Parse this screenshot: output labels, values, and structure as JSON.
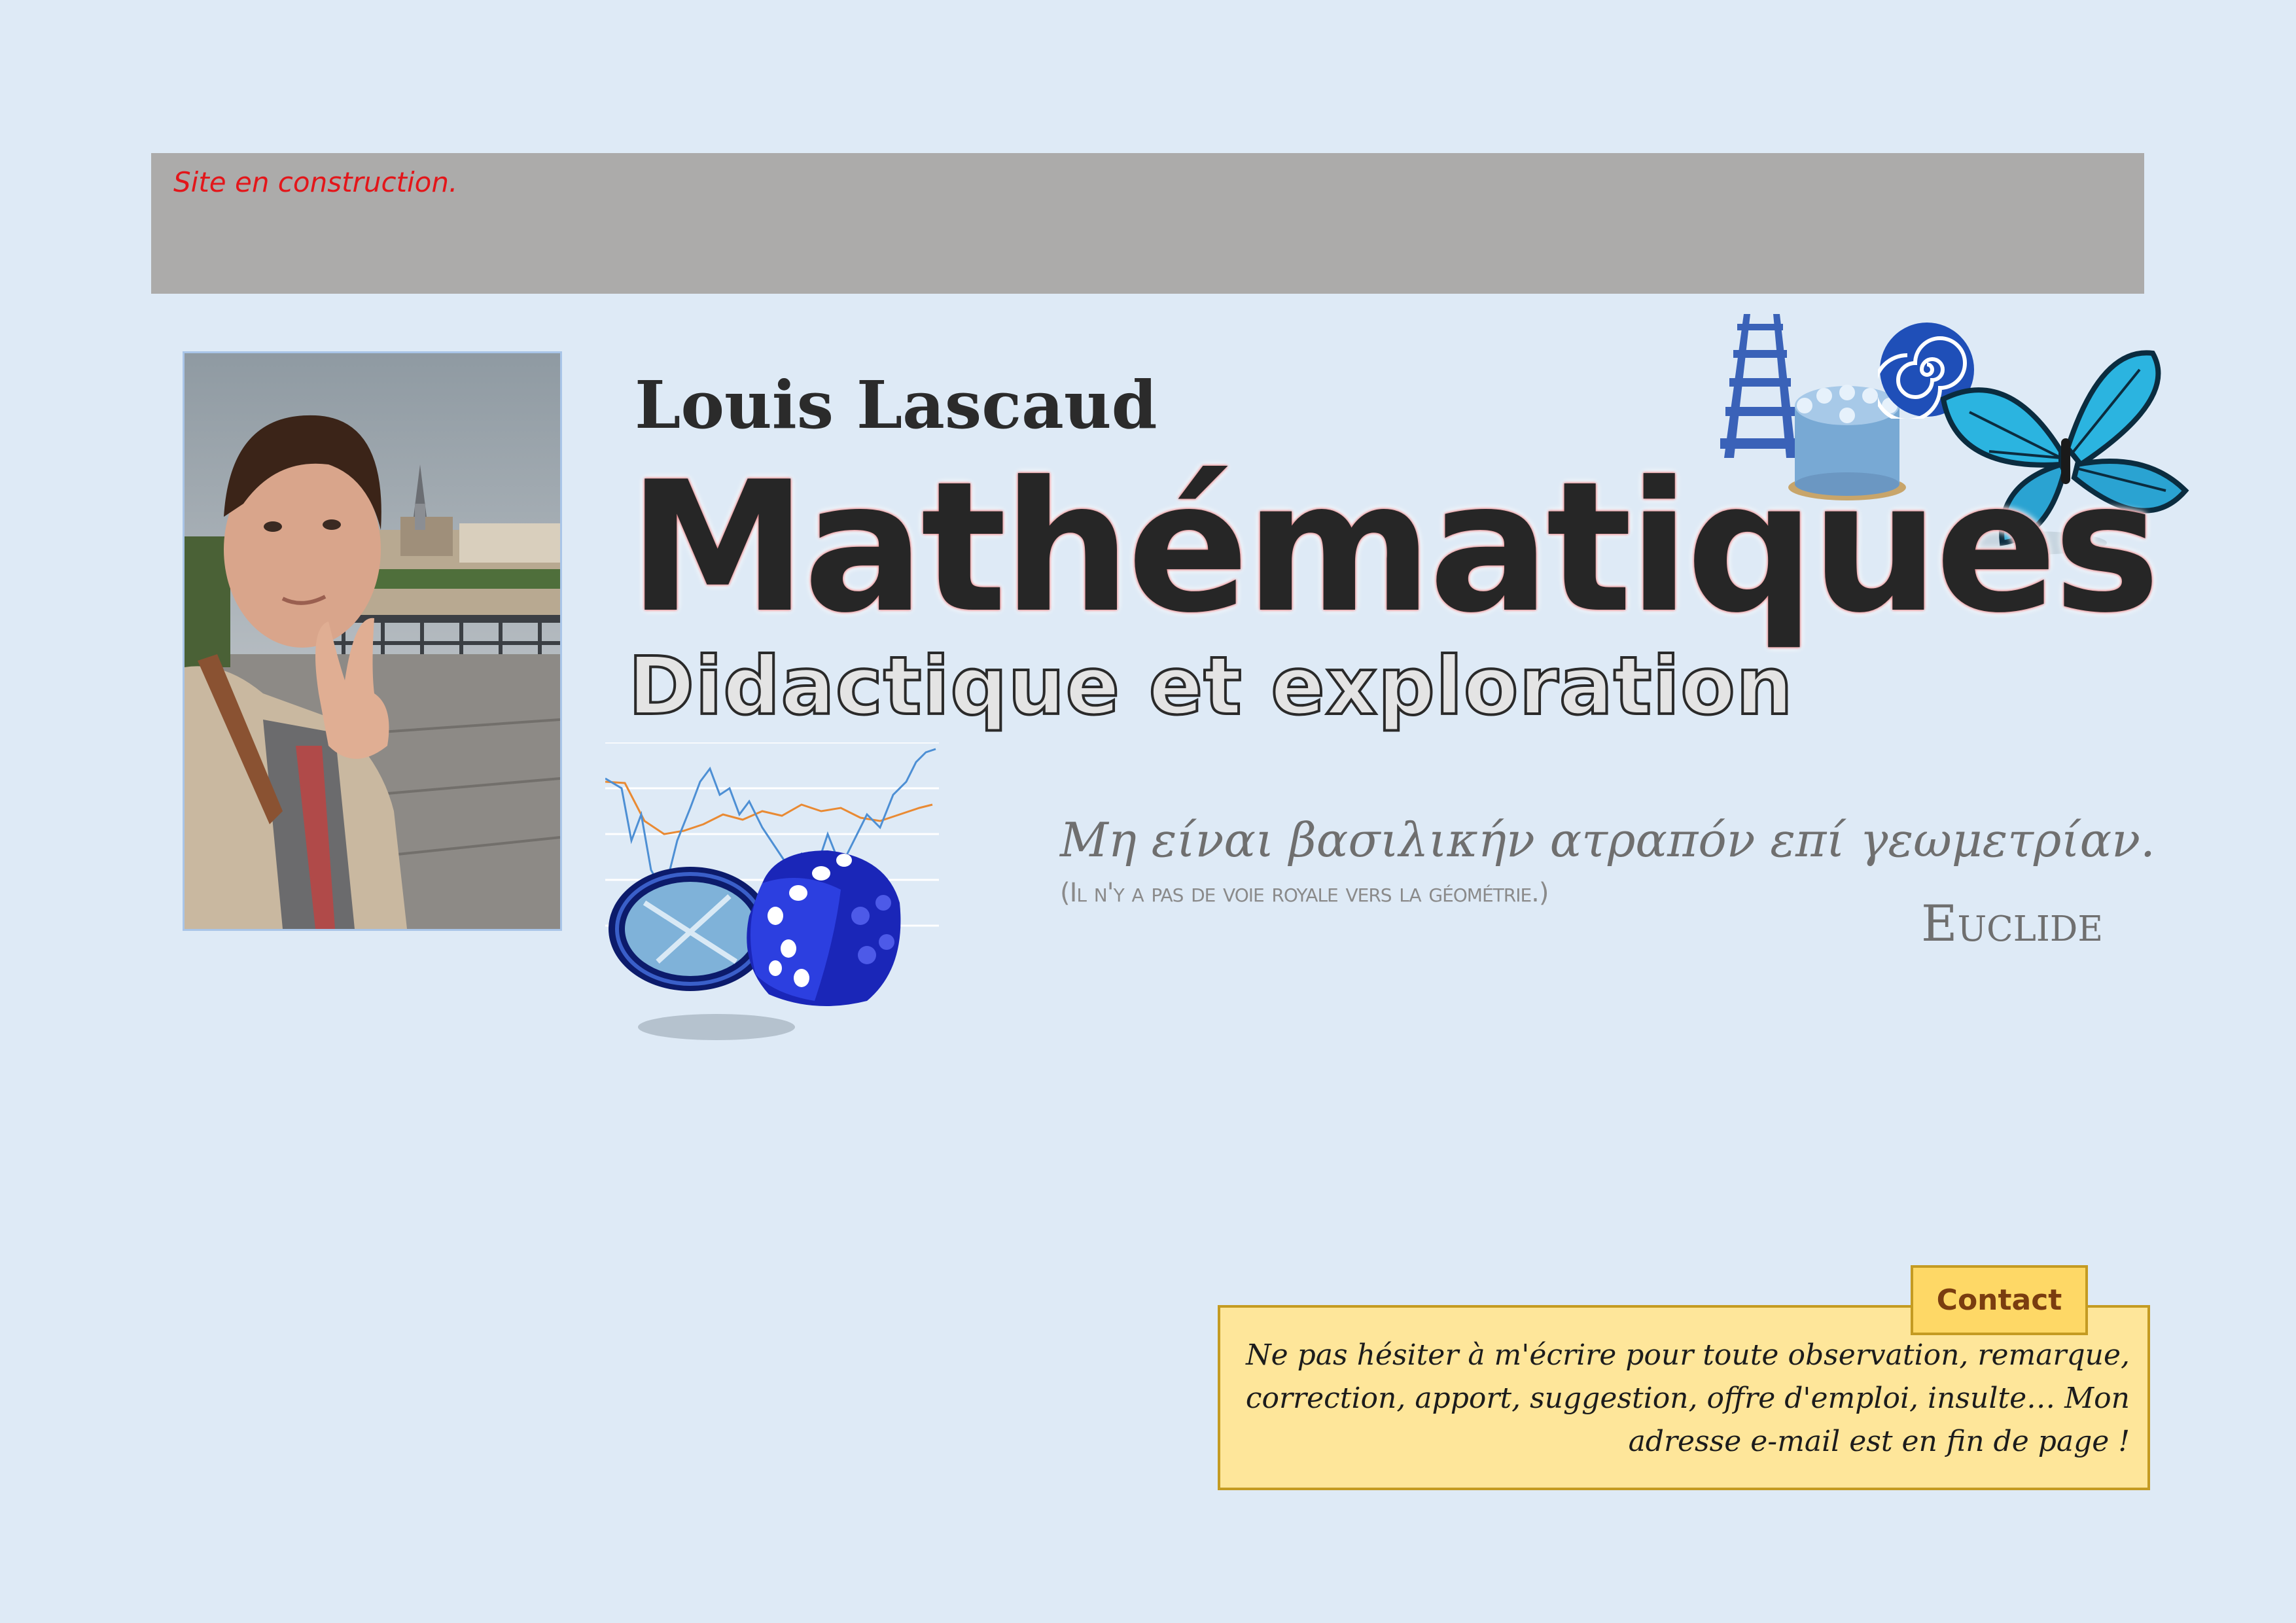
{
  "banner": {
    "text": "Site en construction."
  },
  "author": {
    "name": "Louis Lascaud"
  },
  "header": {
    "title": "Mathématiques",
    "subtitle": "Didactique et exploration"
  },
  "quote": {
    "greek": "Μη είναι βασιλικήν ατραπόν επί γεωμετρίαν.",
    "translation": "(Il n'y a pas de voie royale vers la géométrie.)",
    "author": "Euclide"
  },
  "contact": {
    "tab_label": "Contact",
    "message": "Ne pas hésiter à m'écrire pour toute observation, remarque, correction, apport, suggestion, offre d'emploi, insulte… Mon adresse e-mail est en fin de page !"
  },
  "colors": {
    "background": "#deeaf6",
    "banner": "#acabaa",
    "banner_text": "#e3161a",
    "contact_box": "#fee69a",
    "contact_tab": "#fed866",
    "contact_border": "#c49b22"
  },
  "decorations": {
    "photo": "portrait-photo",
    "top_right": [
      "railway-track-icon",
      "cake-icon",
      "spiral-icon",
      "butterfly-icon"
    ],
    "bottom_left": [
      "line-chart-icon",
      "ring-icon",
      "dice-icon"
    ]
  }
}
